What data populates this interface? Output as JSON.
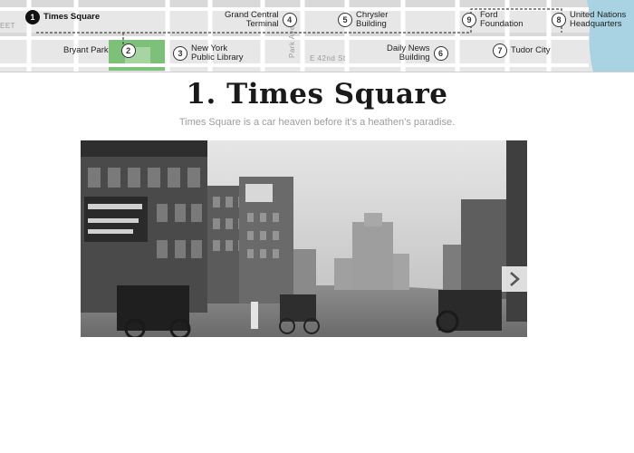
{
  "map": {
    "street_labels": [
      "EET",
      "Park Ave",
      "E 42nd St"
    ],
    "stops": [
      {
        "number": "1",
        "label": "Times Square",
        "active": true
      },
      {
        "number": "2",
        "label": "Bryant Park",
        "active": false
      },
      {
        "number": "3",
        "label": "New York\nPublic Library",
        "active": false
      },
      {
        "number": "4",
        "label": "Grand Central\nTerminal",
        "active": false
      },
      {
        "number": "5",
        "label": "Chrysler\nBuilding",
        "active": false
      },
      {
        "number": "6",
        "label": "Daily News\nBuilding",
        "active": false
      },
      {
        "number": "7",
        "label": "Tudor City",
        "active": false
      },
      {
        "number": "8",
        "label": "United Nations\nHeadquarters",
        "active": false
      },
      {
        "number": "9",
        "label": "Ford\nFoundation",
        "active": false
      }
    ]
  },
  "header": {
    "title": "1. Times Square",
    "subtitle": "Times Square is a car heaven before it’s a heathen’s paradise."
  },
  "photo": {
    "description_icon": "historic-street-photo",
    "next_icon": "chevron-right-icon"
  },
  "colors": {
    "map_background": "#e6e6e6",
    "park_green": "#7cc07a",
    "river_blue": "#a9d2e3",
    "title_text": "#1a1a1a",
    "subtitle_text": "#9c9c9c"
  }
}
